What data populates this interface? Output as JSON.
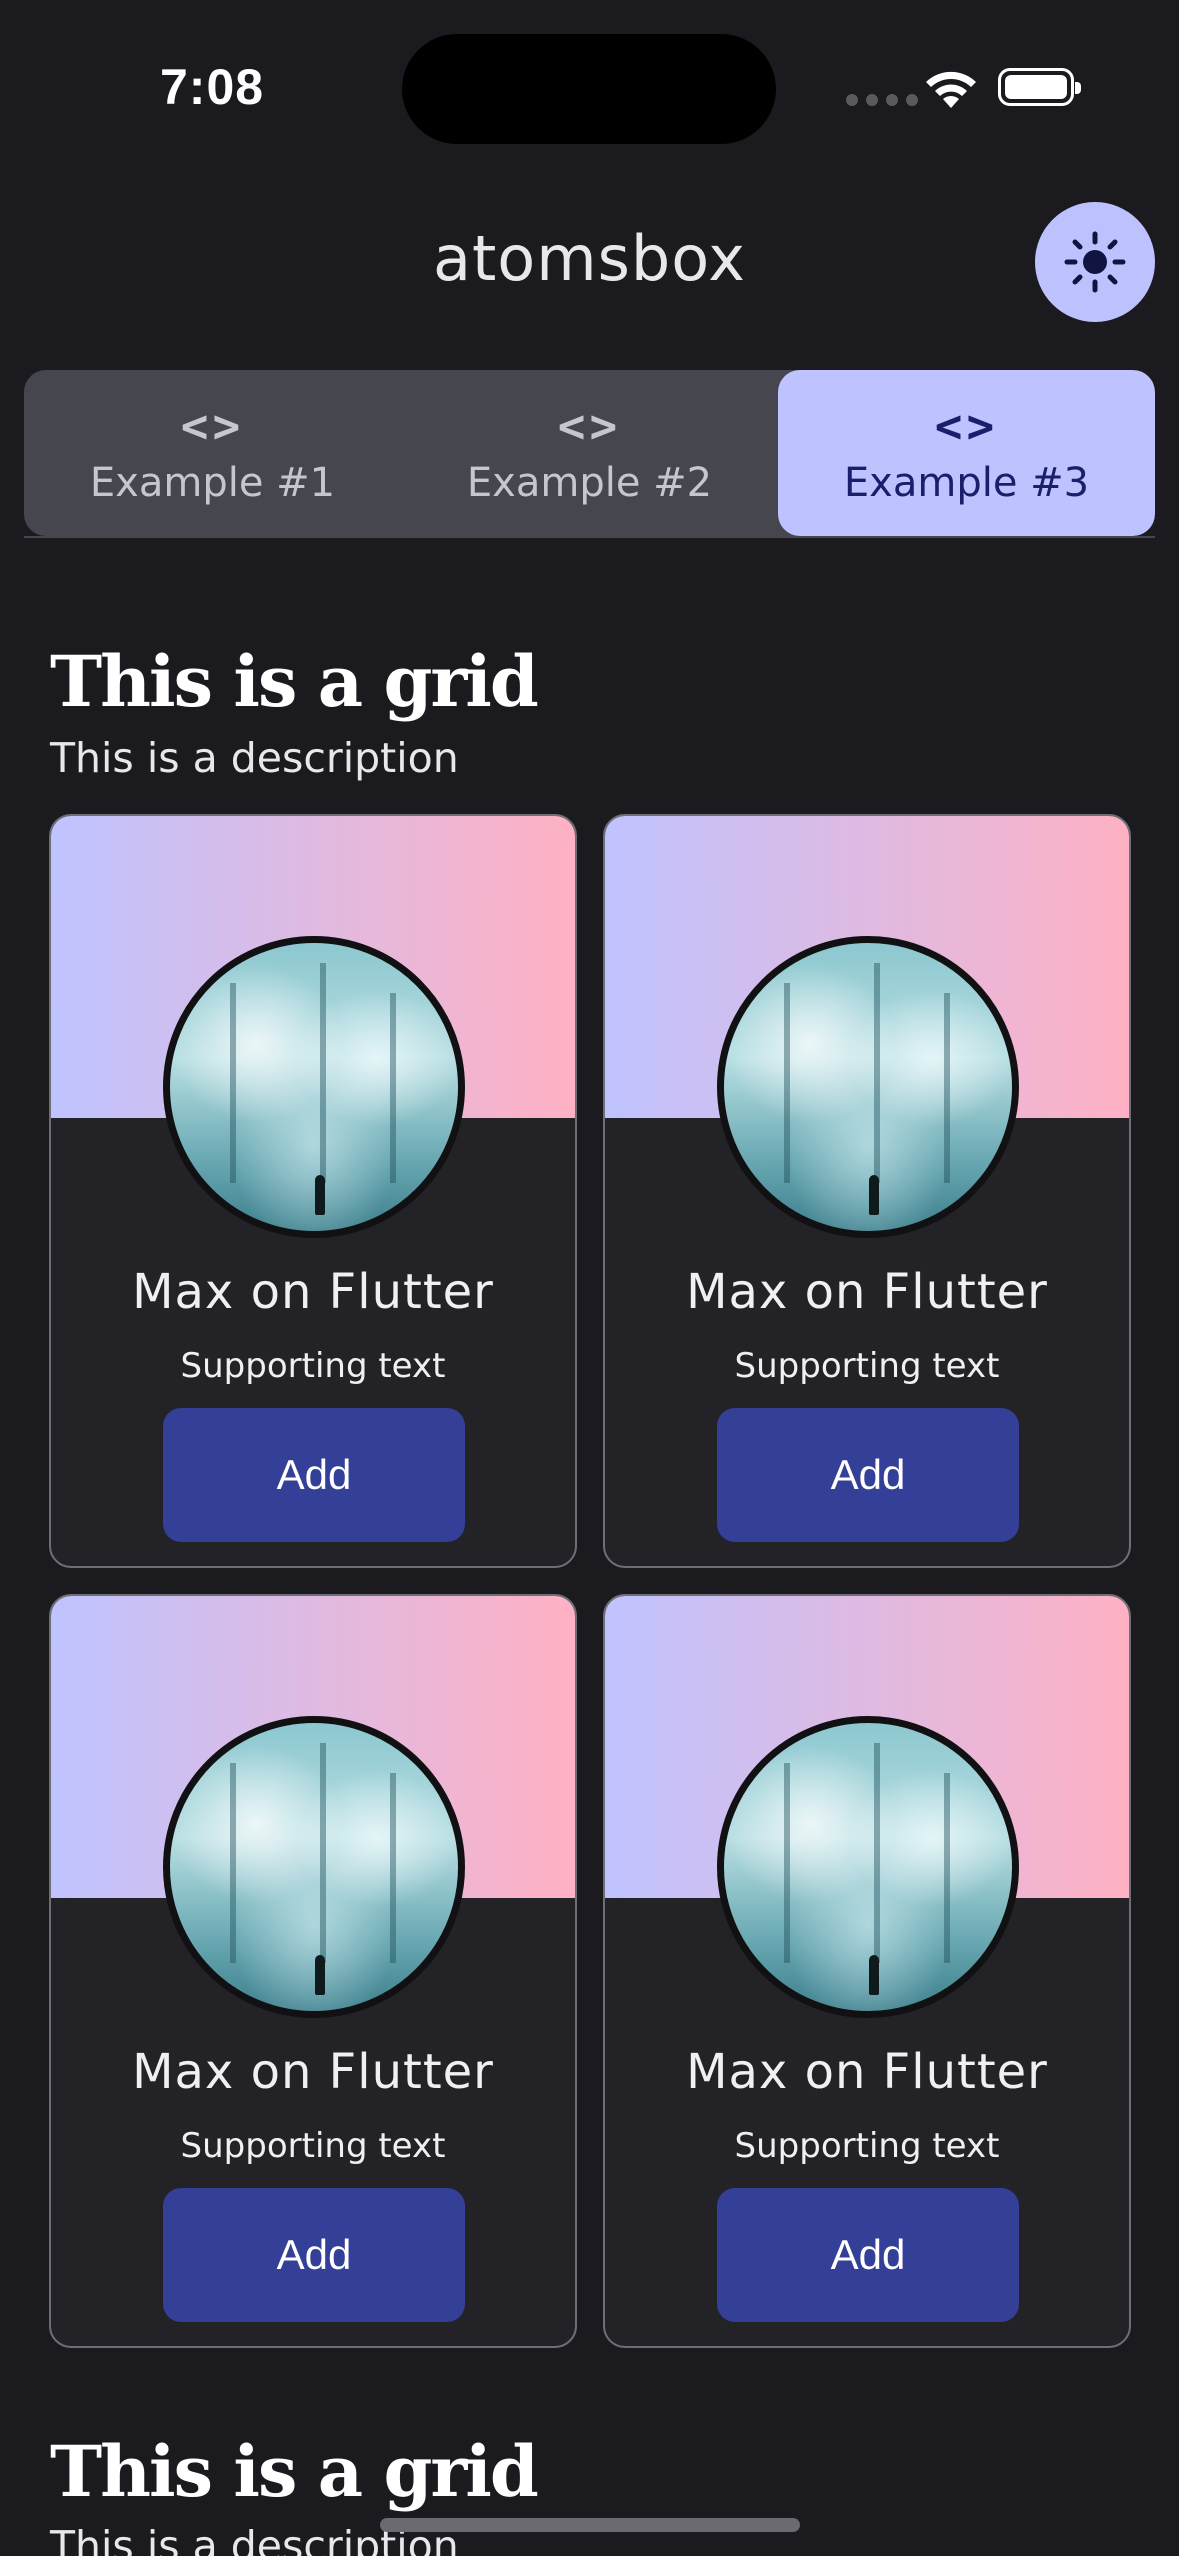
{
  "status_bar": {
    "time": "7:08"
  },
  "app_bar": {
    "title": "atomsbox",
    "theme_icon": "sun-icon"
  },
  "tabs": [
    {
      "label": "Example #1",
      "icon": "code-icon",
      "active": false
    },
    {
      "label": "Example #2",
      "icon": "code-icon",
      "active": false
    },
    {
      "label": "Example #3",
      "icon": "code-icon",
      "active": true
    }
  ],
  "tab_icon_glyph": "<>",
  "sections": [
    {
      "title": "This is a grid",
      "description": "This is a description",
      "cards": [
        {
          "title": "Max on Flutter",
          "subtitle": "Supporting text",
          "button": "Add"
        },
        {
          "title": "Max on Flutter",
          "subtitle": "Supporting text",
          "button": "Add"
        },
        {
          "title": "Max on Flutter",
          "subtitle": "Supporting text",
          "button": "Add"
        },
        {
          "title": "Max on Flutter",
          "subtitle": "Supporting text",
          "button": "Add"
        }
      ]
    },
    {
      "title": "This is a grid",
      "description": "This is a description"
    }
  ],
  "colors": {
    "background": "#1b1b1f",
    "primary_container": "#bec2ff",
    "button": "#343f98",
    "gradient_start": "#bfc3ff",
    "gradient_end": "#ffb1c4"
  }
}
